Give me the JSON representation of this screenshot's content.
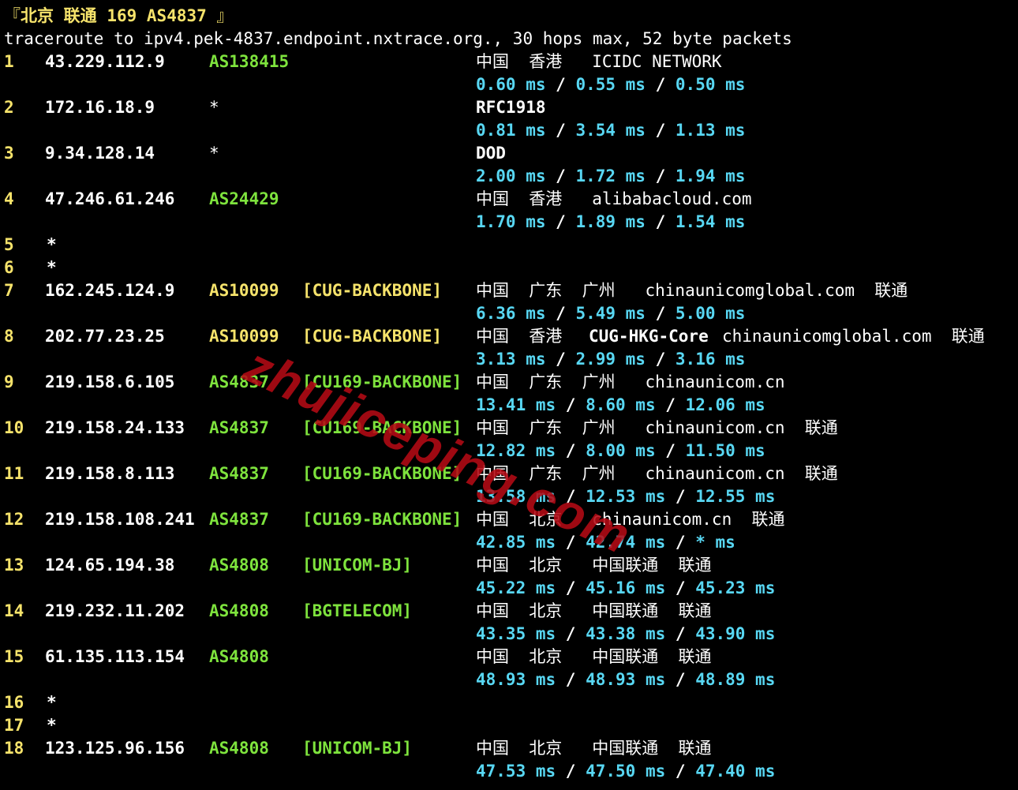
{
  "header": {
    "open_bracket": "『",
    "city": "北京",
    "isp": "联通",
    "line": "169",
    "asn": "AS4837",
    "close_bracket": "』"
  },
  "trace_command": "traceroute to ipv4.pek-4837.endpoint.nxtrace.org., 30 hops max, 52 byte packets",
  "hops": [
    {
      "num": "1",
      "ip": "43.229.112.9",
      "as": "AS138415",
      "net": "",
      "geo": "中国  香港   ICIDC NETWORK",
      "rtt": [
        "0.60 ms",
        "0.55 ms",
        "0.50 ms"
      ]
    },
    {
      "num": "2",
      "ip": "172.16.18.9",
      "as": "*",
      "net": "",
      "geo": "RFC1918",
      "rtt": [
        "0.81 ms",
        "3.54 ms",
        "1.13 ms"
      ]
    },
    {
      "num": "3",
      "ip": "9.34.128.14",
      "as": "*",
      "net": "",
      "geo": "DOD",
      "rtt": [
        "2.00 ms",
        "1.72 ms",
        "1.94 ms"
      ]
    },
    {
      "num": "4",
      "ip": "47.246.61.246",
      "as": "AS24429",
      "net": "",
      "geo": "中国  香港   alibabacloud.com",
      "rtt": [
        "1.70 ms",
        "1.89 ms",
        "1.54 ms"
      ]
    },
    {
      "num": "5",
      "ip": "*"
    },
    {
      "num": "6",
      "ip": "*"
    },
    {
      "num": "7",
      "ip": "162.245.124.9",
      "as": "AS10099",
      "net": "[CUG-BACKBONE]",
      "geo": "中国  广东  广州   chinaunicomglobal.com  联通",
      "rtt": [
        "6.36 ms",
        "5.49 ms",
        "5.00 ms"
      ]
    },
    {
      "num": "8",
      "ip": "202.77.23.25",
      "as": "AS10099",
      "net": "[CUG-BACKBONE]",
      "geo_bold": "CUG-HKG-Core",
      "geo_pre": "中国  香港  ",
      "geo": "chinaunicomglobal.com  联通",
      "rtt": [
        "3.13 ms",
        "2.99 ms",
        "3.16 ms"
      ]
    },
    {
      "num": "9",
      "ip": "219.158.6.105",
      "as": "AS4837",
      "net": "[CU169-BACKBONE]",
      "geo": "中国  广东  广州   chinaunicom.cn",
      "rtt": [
        "13.41 ms",
        "8.60 ms",
        "12.06 ms"
      ]
    },
    {
      "num": "10",
      "ip": "219.158.24.133",
      "as": "AS4837",
      "net": "[CU169-BACKBONE]",
      "geo": "中国  广东  广州   chinaunicom.cn  联通",
      "rtt": [
        "12.82 ms",
        "8.00 ms",
        "11.50 ms"
      ]
    },
    {
      "num": "11",
      "ip": "219.158.8.113",
      "as": "AS4837",
      "net": "[CU169-BACKBONE]",
      "geo": "中国  广东  广州   chinaunicom.cn  联通",
      "rtt": [
        "13.58 ms",
        "12.53 ms",
        "12.55 ms"
      ]
    },
    {
      "num": "12",
      "ip": "219.158.108.241",
      "as": "AS4837",
      "net": "[CU169-BACKBONE]",
      "geo": "中国  北京   chinaunicom.cn  联通",
      "rtt": [
        "42.85 ms",
        "42.74 ms",
        "* ms"
      ]
    },
    {
      "num": "13",
      "ip": "124.65.194.38",
      "as": "AS4808",
      "net": "[UNICOM-BJ]",
      "geo": "中国  北京   中国联通  联通",
      "rtt": [
        "45.22 ms",
        "45.16 ms",
        "45.23 ms"
      ]
    },
    {
      "num": "14",
      "ip": "219.232.11.202",
      "as": "AS4808",
      "net": "[BGTELECOM]",
      "geo": "中国  北京   中国联通  联通",
      "rtt": [
        "43.35 ms",
        "43.38 ms",
        "43.90 ms"
      ]
    },
    {
      "num": "15",
      "ip": "61.135.113.154",
      "as": "AS4808",
      "net": "",
      "geo": "中国  北京   中国联通  联通",
      "rtt": [
        "48.93 ms",
        "48.93 ms",
        "48.89 ms"
      ]
    },
    {
      "num": "16",
      "ip": "*"
    },
    {
      "num": "17",
      "ip": "*"
    },
    {
      "num": "18",
      "ip": "123.125.96.156",
      "as": "AS4808",
      "net": "[UNICOM-BJ]",
      "geo": "中国  北京   中国联通  联通",
      "rtt": [
        "47.53 ms",
        "47.50 ms",
        "47.40 ms"
      ]
    }
  ],
  "watermark": "zhujiceping.com",
  "colors": {
    "background": "#000000",
    "yellow": "#f6e36b",
    "green": "#7ee33d",
    "cyan": "#58d7f3",
    "watermark": "#b40a14"
  }
}
